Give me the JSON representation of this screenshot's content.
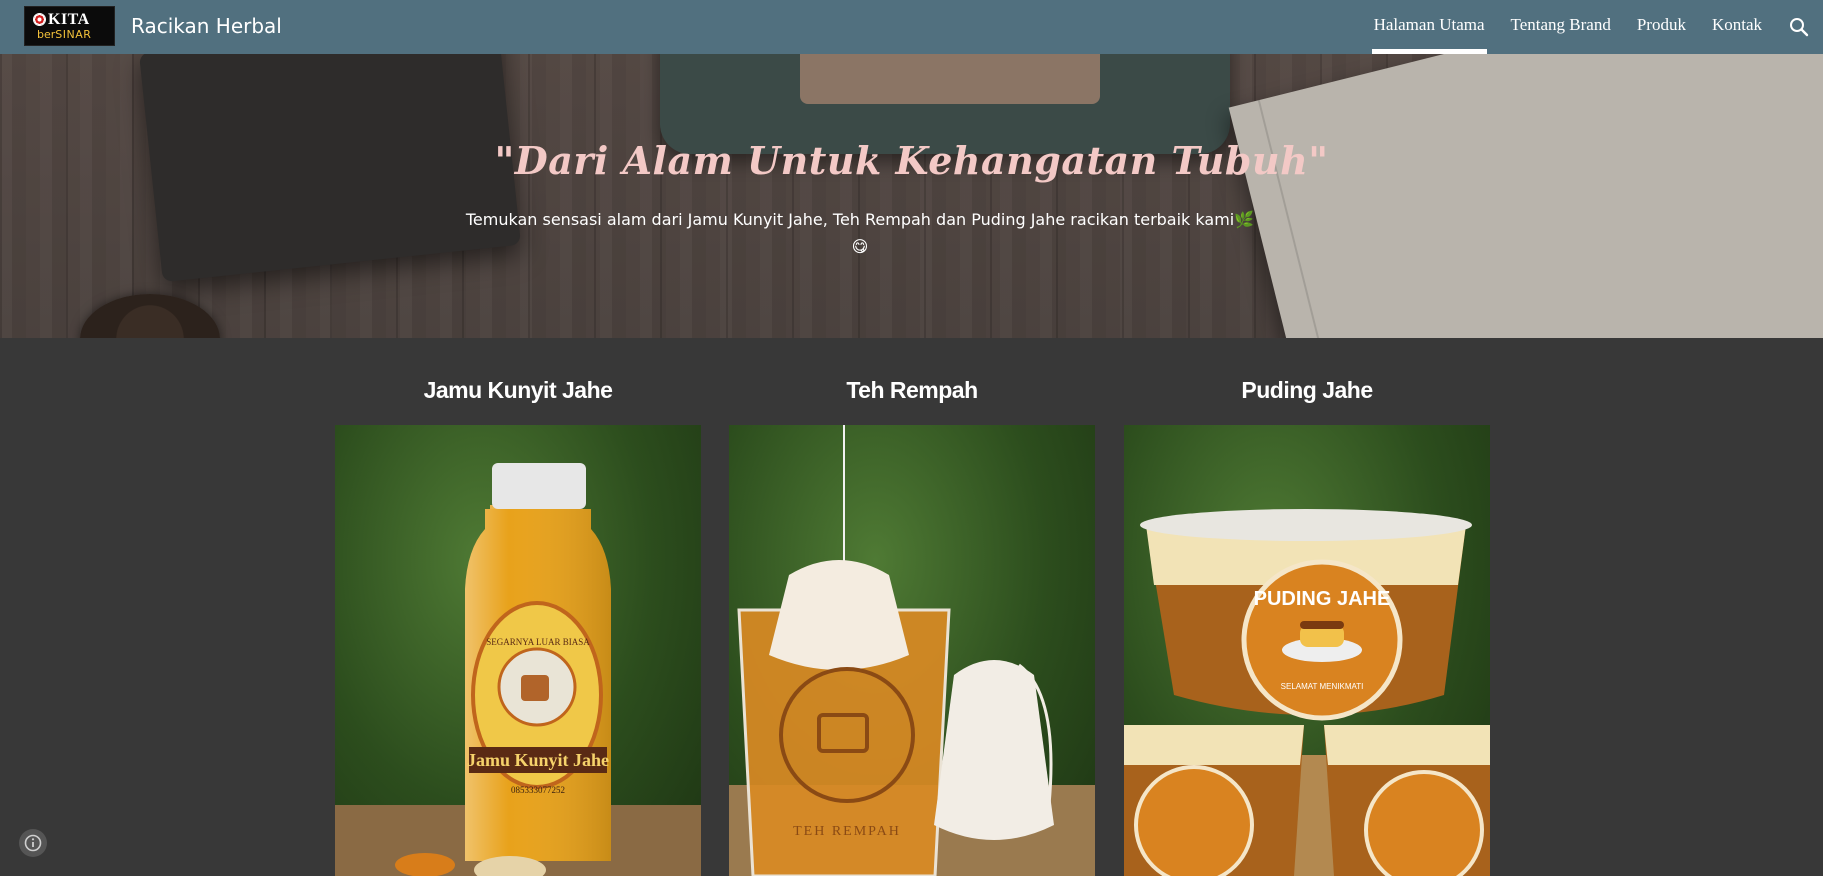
{
  "site": {
    "logo_text_top": "KITA",
    "logo_text_ber": "ber",
    "logo_text_sinar": "SINAR",
    "title": "Racikan Herbal"
  },
  "nav": {
    "items": [
      {
        "label": "Halaman Utama",
        "active": true
      },
      {
        "label": "Tentang Brand",
        "active": false
      },
      {
        "label": "Produk",
        "active": false
      },
      {
        "label": "Kontak",
        "active": false
      }
    ],
    "search_icon": "search-icon"
  },
  "hero": {
    "quote": "\"Dari Alam Untuk Kehangatan Tubuh\"",
    "description": "Temukan sensasi alam dari Jamu Kunyit Jahe, Teh Rempah dan Puding Jahe racikan terbaik kami🌿",
    "description_emoji": "😋"
  },
  "products": [
    {
      "title": "Jamu Kunyit Jahe",
      "label_top": "SEGARNYA LUAR BIASA",
      "label_name": "Jamu Kunyit Jahe",
      "label_phone": "085333077252"
    },
    {
      "title": "Teh Rempah",
      "label_name": "TEH REMPAH"
    },
    {
      "title": "Puding Jahe",
      "label_name": "PUDING JAHE",
      "label_sub": "SELAMAT MENIKMATI"
    }
  ],
  "footer": {
    "info_icon": "info-icon"
  },
  "colors": {
    "topbar": "#51707f",
    "page_bg": "#383838",
    "quote": "#f3c9c6"
  }
}
